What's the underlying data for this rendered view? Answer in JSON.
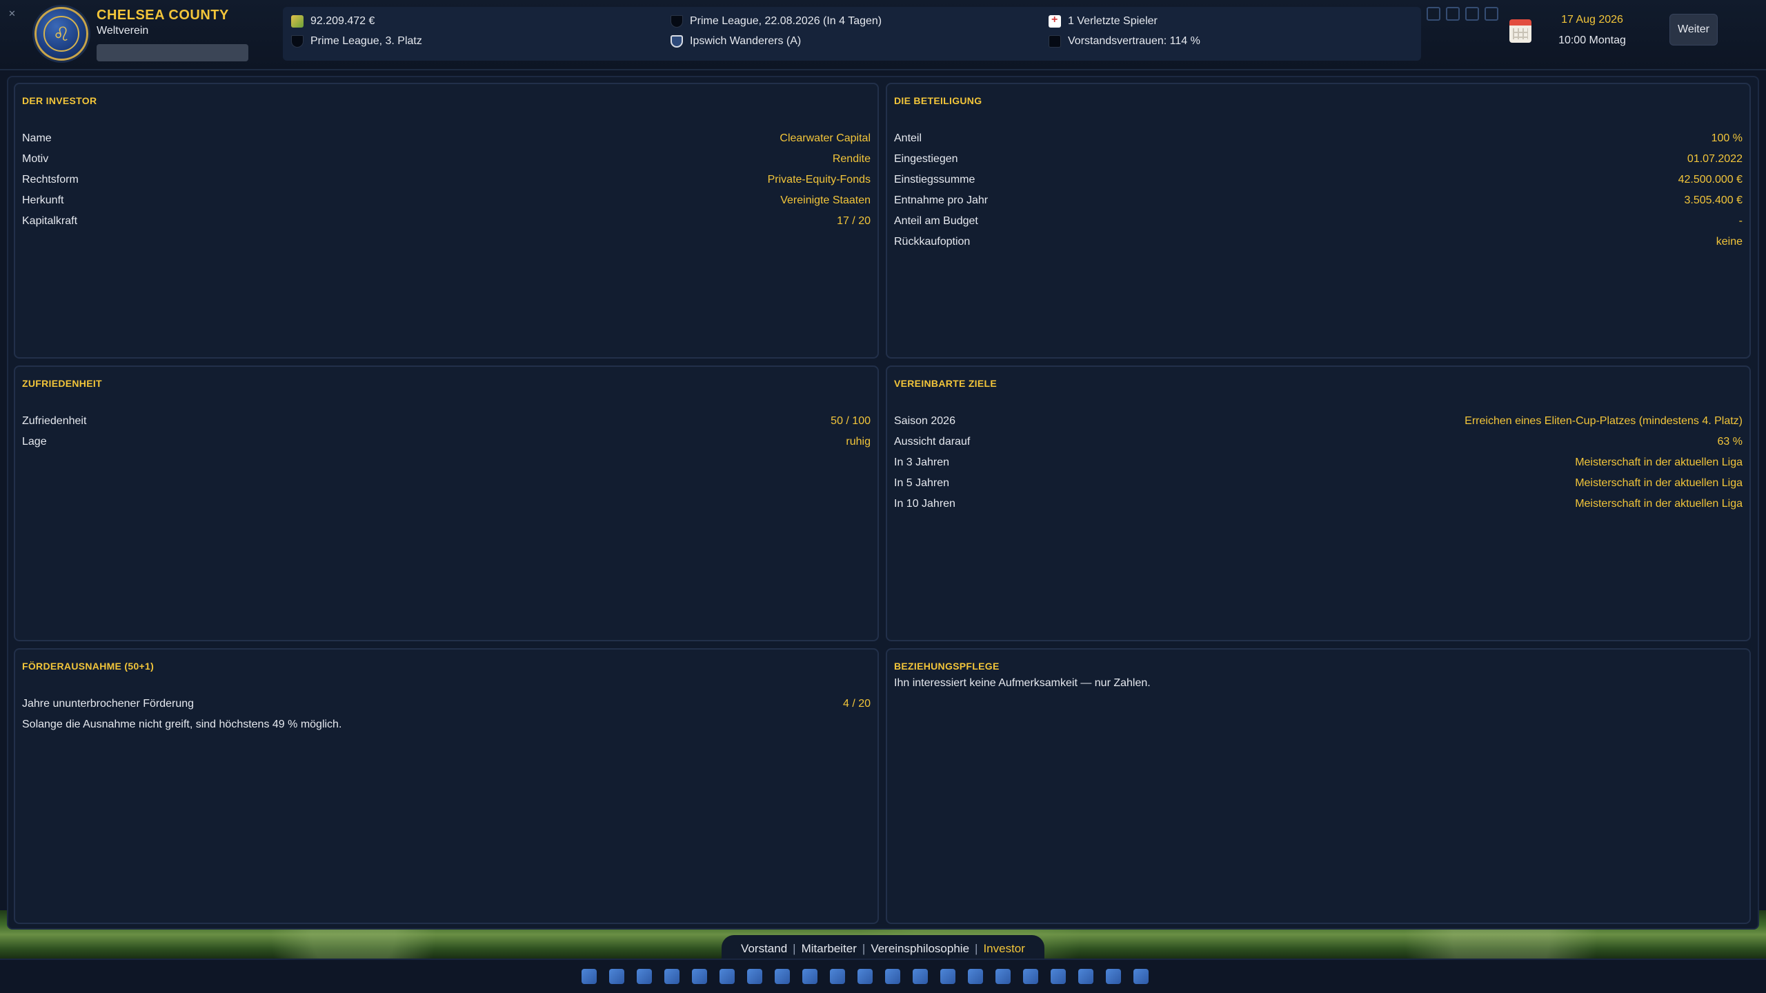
{
  "club": {
    "name": "CHELSEA COUNTY",
    "subtitle": "Weltverein"
  },
  "info": {
    "money": "92.209.472 €",
    "league_position": "Prime League, 3. Platz",
    "next_match": "Prime League, 22.08.2026 (In 4 Tagen)",
    "next_opponent": "Ipswich Wanderers (A)",
    "injuries": "1 Verletzte Spieler",
    "board_trust": "Vorstandsvertrauen: 114 %"
  },
  "datetime": {
    "date": "17 Aug 2026",
    "time": "10:00 Montag"
  },
  "continue_label": "Weiter",
  "panels": {
    "investor": {
      "title": "DER INVESTOR",
      "rows": [
        {
          "key": "Name",
          "value": "Clearwater Capital"
        },
        {
          "key": "Motiv",
          "value": "Rendite"
        },
        {
          "key": "Rechtsform",
          "value": "Private-Equity-Fonds"
        },
        {
          "key": "Herkunft",
          "value": "Vereinigte Staaten"
        },
        {
          "key": "Kapitalkraft",
          "value": "17 / 20"
        }
      ]
    },
    "stake": {
      "title": "DIE BETEILIGUNG",
      "rows": [
        {
          "key": "Anteil",
          "value": "100 %"
        },
        {
          "key": "Eingestiegen",
          "value": "01.07.2022"
        },
        {
          "key": "Einstiegssumme",
          "value": "42.500.000 €"
        },
        {
          "key": "Entnahme pro Jahr",
          "value": "3.505.400 €"
        },
        {
          "key": "Anteil am Budget",
          "value": "-"
        },
        {
          "key": "Rückkaufoption",
          "value": "keine"
        }
      ]
    },
    "satisfaction": {
      "title": "ZUFRIEDENHEIT",
      "rows": [
        {
          "key": "Zufriedenheit",
          "value": "50 / 100"
        },
        {
          "key": "Lage",
          "value": "ruhig"
        }
      ]
    },
    "goals": {
      "title": "VEREINBARTE ZIELE",
      "rows": [
        {
          "key": "Saison 2026",
          "value": "Erreichen eines Eliten-Cup-Platzes (mindestens 4. Platz)"
        },
        {
          "key": "Aussicht darauf",
          "value": "63 %"
        },
        {
          "key": "In 3 Jahren",
          "value": "Meisterschaft in der aktuellen Liga"
        },
        {
          "key": "In 5 Jahren",
          "value": "Meisterschaft in der aktuellen Liga"
        },
        {
          "key": "In 10 Jahren",
          "value": "Meisterschaft in der aktuellen Liga"
        }
      ]
    },
    "exception": {
      "title": "FÖRDERAUSNAHME (50+1)",
      "rows": [
        {
          "key": "Jahre ununterbrochener Förderung",
          "value": "4 / 20"
        }
      ],
      "note": "Solange die Ausnahme nicht greift, sind höchstens 49 % möglich."
    },
    "relations": {
      "title": "BEZIEHUNGSPFLEGE",
      "note": "Ihn interessiert keine Aufmerksamkeit — nur Zahlen."
    }
  },
  "tabs": [
    "Vorstand",
    "Mitarbeiter",
    "Vereinsphilosophie",
    "Investor"
  ],
  "active_tab": "Investor",
  "toolbar_icons": [
    "clipboard-icon",
    "settings-people-icon",
    "search-icon",
    "player-icon",
    "medical-icon",
    "car-icon",
    "building-icon",
    "coach-icon",
    "notepad-icon",
    "handshake-icon",
    "stats-icon",
    "calendar-grid-icon",
    "trophy-icon",
    "cup-icon",
    "stars-icon",
    "mail-icon",
    "manager-icon",
    "scout-icon",
    "staff-icon",
    "bar-chart-icon",
    "schedule-icon"
  ]
}
